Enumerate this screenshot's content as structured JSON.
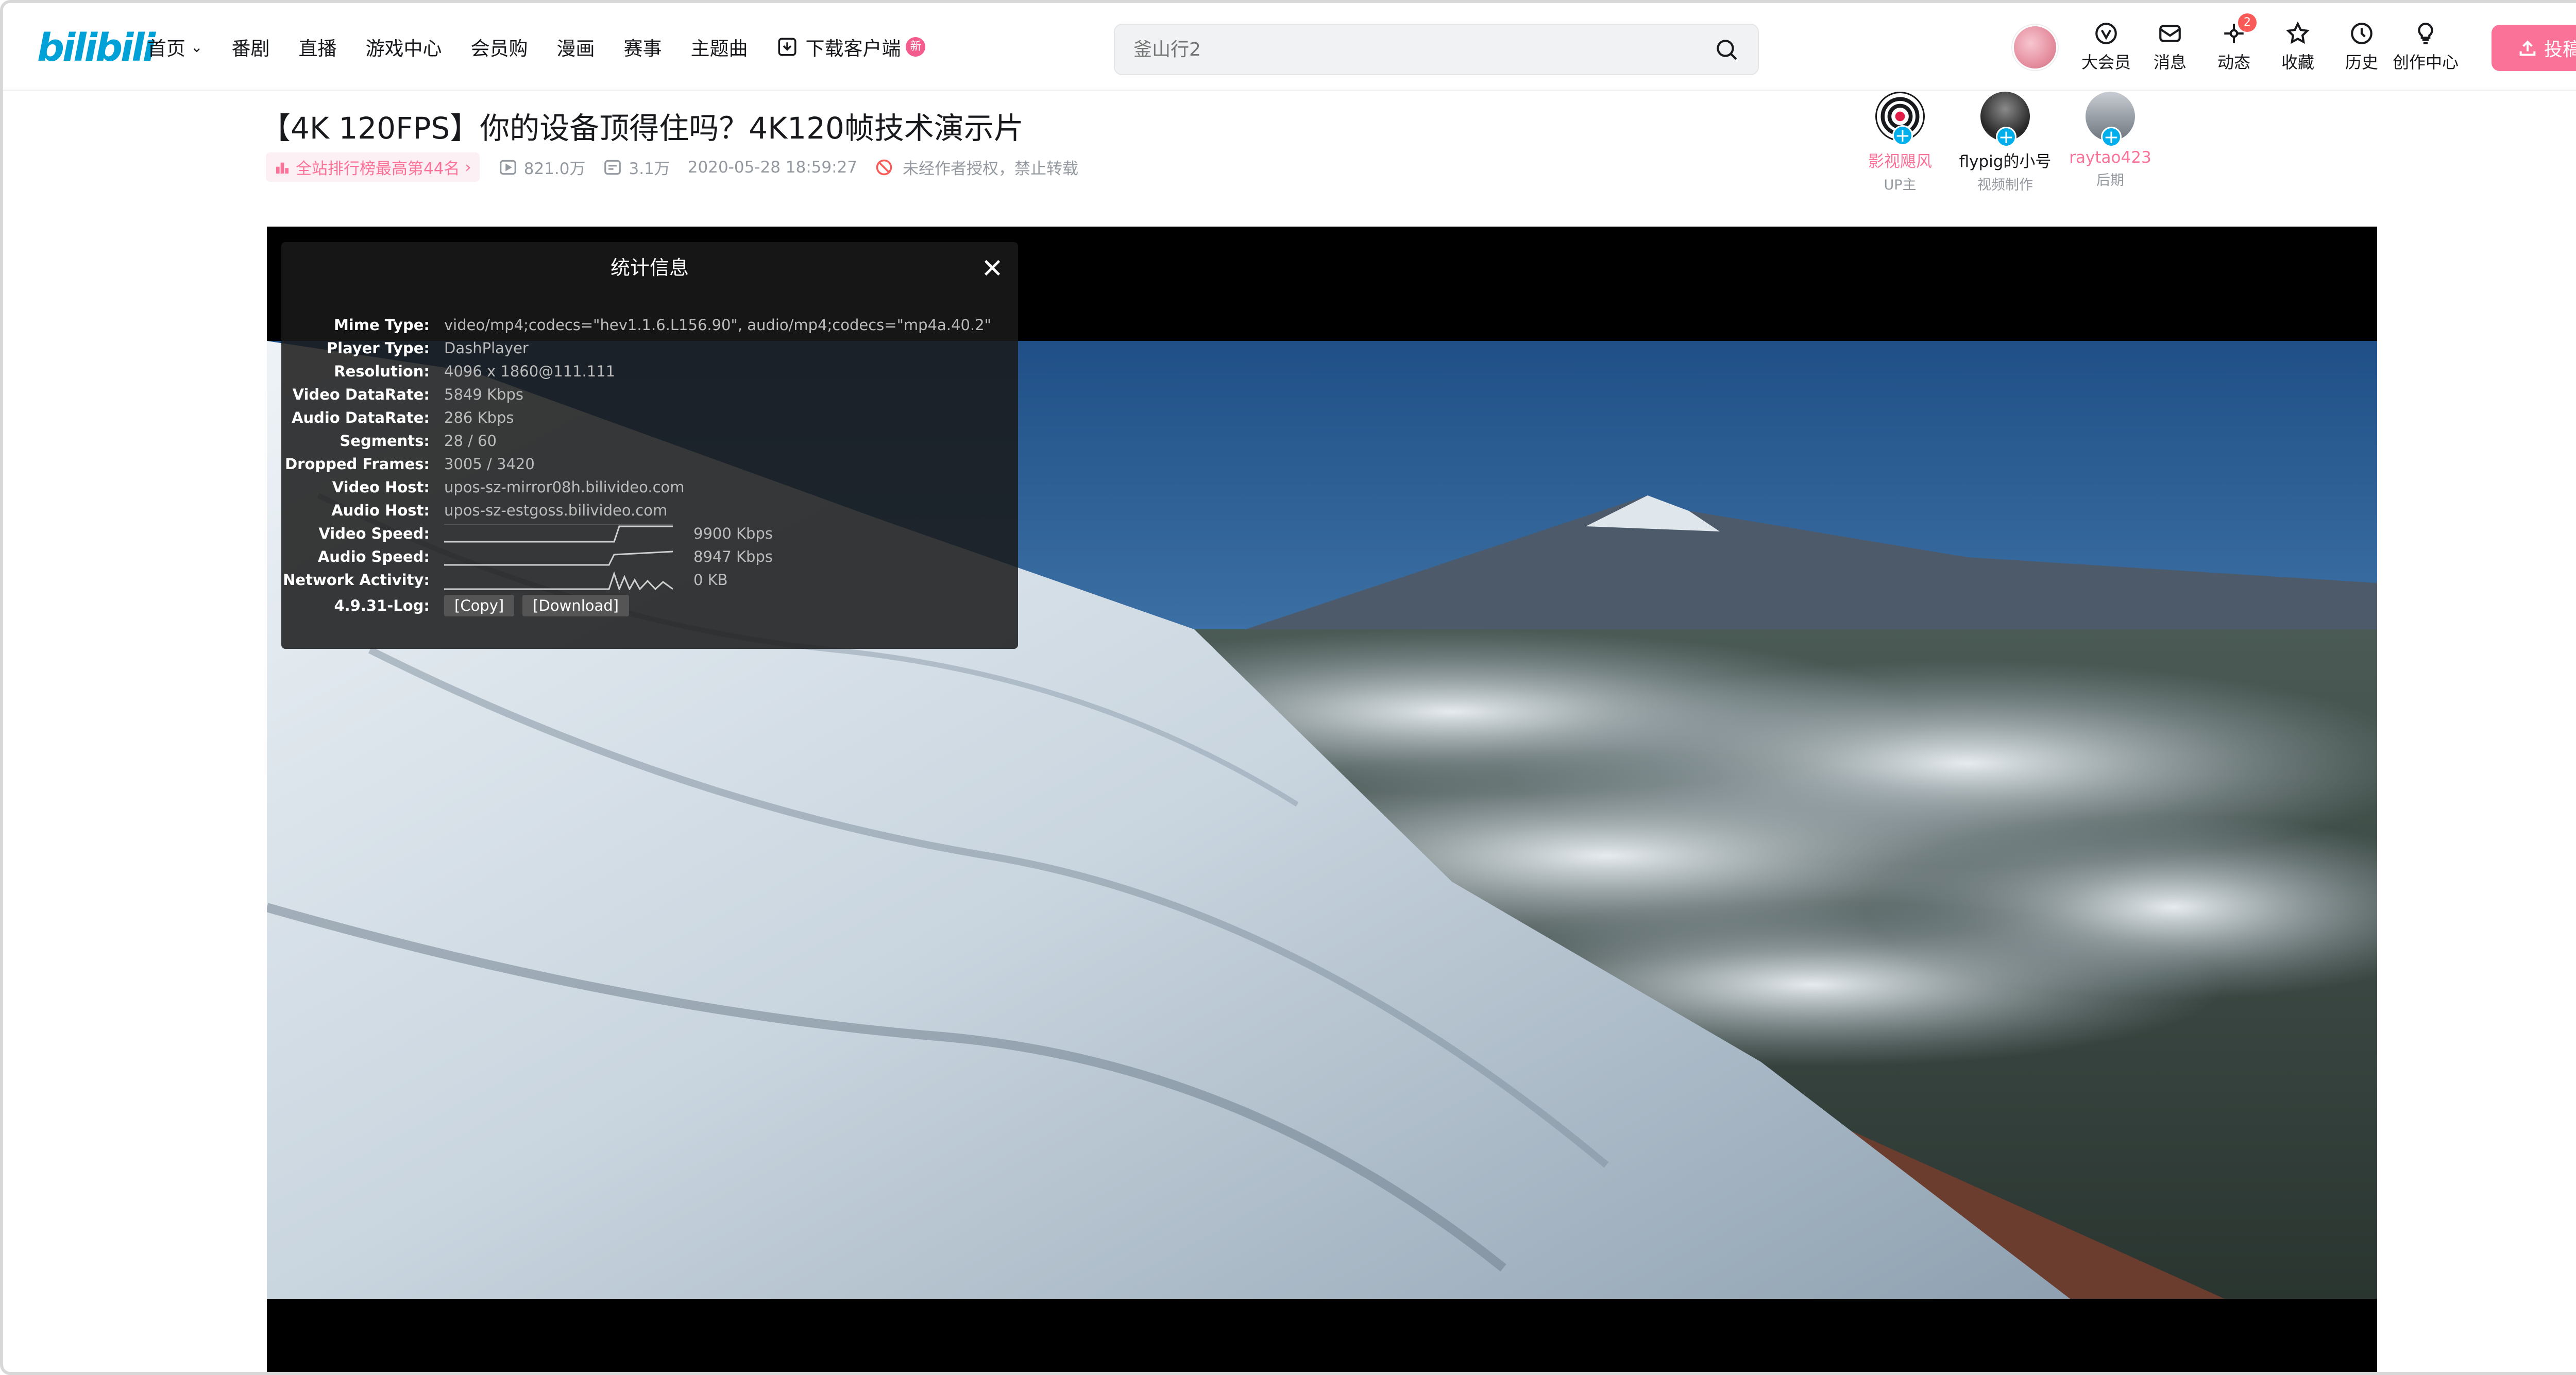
{
  "header": {
    "logo": "bilibili",
    "nav": [
      "首页",
      "番剧",
      "直播",
      "游戏中心",
      "会员购",
      "漫画",
      "赛事",
      "主题曲",
      "下载客户端"
    ],
    "new_badge": "新",
    "search_placeholder": "釜山行2",
    "icons": [
      {
        "label": "大会员",
        "icon": "vip-icon"
      },
      {
        "label": "消息",
        "icon": "message-icon"
      },
      {
        "label": "动态",
        "icon": "dynamic-icon",
        "badge": "2"
      },
      {
        "label": "收藏",
        "icon": "star-icon"
      },
      {
        "label": "历史",
        "icon": "history-icon"
      },
      {
        "label": "创作中心",
        "icon": "bulb-icon"
      }
    ],
    "upload_label": "投稿"
  },
  "video": {
    "title": "【4K 120FPS】你的设备顶得住吗？4K120帧技术演示片",
    "rank": "全站排行榜最高第44名",
    "views": "821.0万",
    "danmaku": "3.1万",
    "date": "2020-05-28 18:59:27",
    "copyright": "未经作者授权，禁止转载"
  },
  "creators": [
    {
      "name": "影视飓风",
      "role": "UP主",
      "color": "#fb7299"
    },
    {
      "name": "flypig的小号",
      "role": "视频制作",
      "color": "#18191c"
    },
    {
      "name": "raytao423",
      "role": "后期",
      "color": "#fb7299"
    }
  ],
  "stats": {
    "title": "统计信息",
    "rows": [
      {
        "k": "Mime Type:",
        "v": "video/mp4;codecs=\"hev1.1.6.L156.90\", audio/mp4;codecs=\"mp4a.40.2\""
      },
      {
        "k": "Player Type:",
        "v": "DashPlayer"
      },
      {
        "k": "Resolution:",
        "v": "4096 x 1860@111.111"
      },
      {
        "k": "Video DataRate:",
        "v": "5849 Kbps"
      },
      {
        "k": "Audio DataRate:",
        "v": "286 Kbps"
      },
      {
        "k": "Segments:",
        "v": "28 / 60"
      },
      {
        "k": "Dropped Frames:",
        "v": "3005 / 3420"
      },
      {
        "k": "Video Host:",
        "v": "upos-sz-mirror08h.bilivideo.com"
      },
      {
        "k": "Audio Host:",
        "v": "upos-sz-estgoss.bilivideo.com"
      }
    ],
    "video_speed_label": "Video Speed:",
    "video_speed": "9900 Kbps",
    "audio_speed_label": "Audio Speed:",
    "audio_speed": "8947 Kbps",
    "network_label": "Network Activity:",
    "network": "0 KB",
    "log_label": "4.9.31-Log:",
    "copy_label": "[Copy]",
    "download_label": "[Download]"
  }
}
